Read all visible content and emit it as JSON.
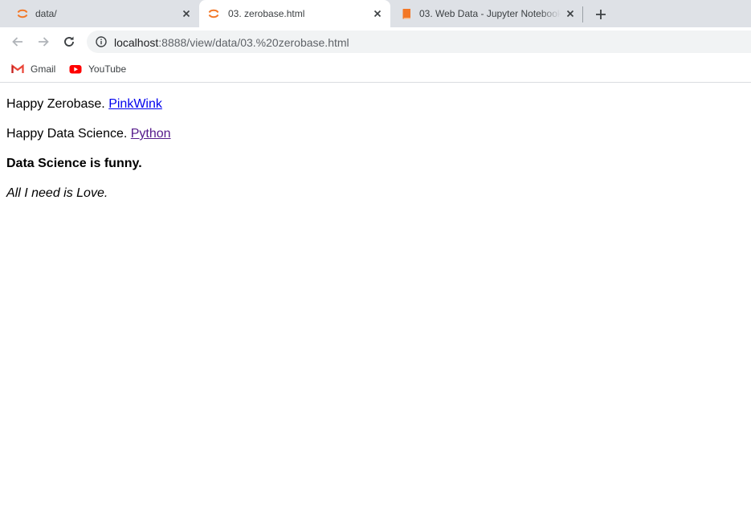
{
  "tabs": [
    {
      "title": "data/",
      "icon": "jupyter-icon",
      "active": false
    },
    {
      "title": "03. zerobase.html",
      "icon": "jupyter-icon",
      "active": true
    },
    {
      "title": "03. Web Data - Jupyter Notebook",
      "icon": "notebook-icon",
      "active": false
    }
  ],
  "address_bar": {
    "host": "localhost",
    "path": ":8888/view/data/03.%20zerobase.html"
  },
  "bookmarks": [
    {
      "label": "Gmail",
      "icon": "gmail-icon"
    },
    {
      "label": "YouTube",
      "icon": "youtube-icon"
    }
  ],
  "page": {
    "line1": {
      "text": "Happy Zerobase. ",
      "link": "PinkWink"
    },
    "line2": {
      "text": "Happy Data Science. ",
      "link": "Python"
    },
    "line3": "Data Science is funny.",
    "line4": "All I need is Love."
  },
  "colors": {
    "jupyter_orange": "#f37726",
    "link": "#0000ee",
    "visited_link": "#551a8b",
    "youtube_red": "#ff0000"
  }
}
